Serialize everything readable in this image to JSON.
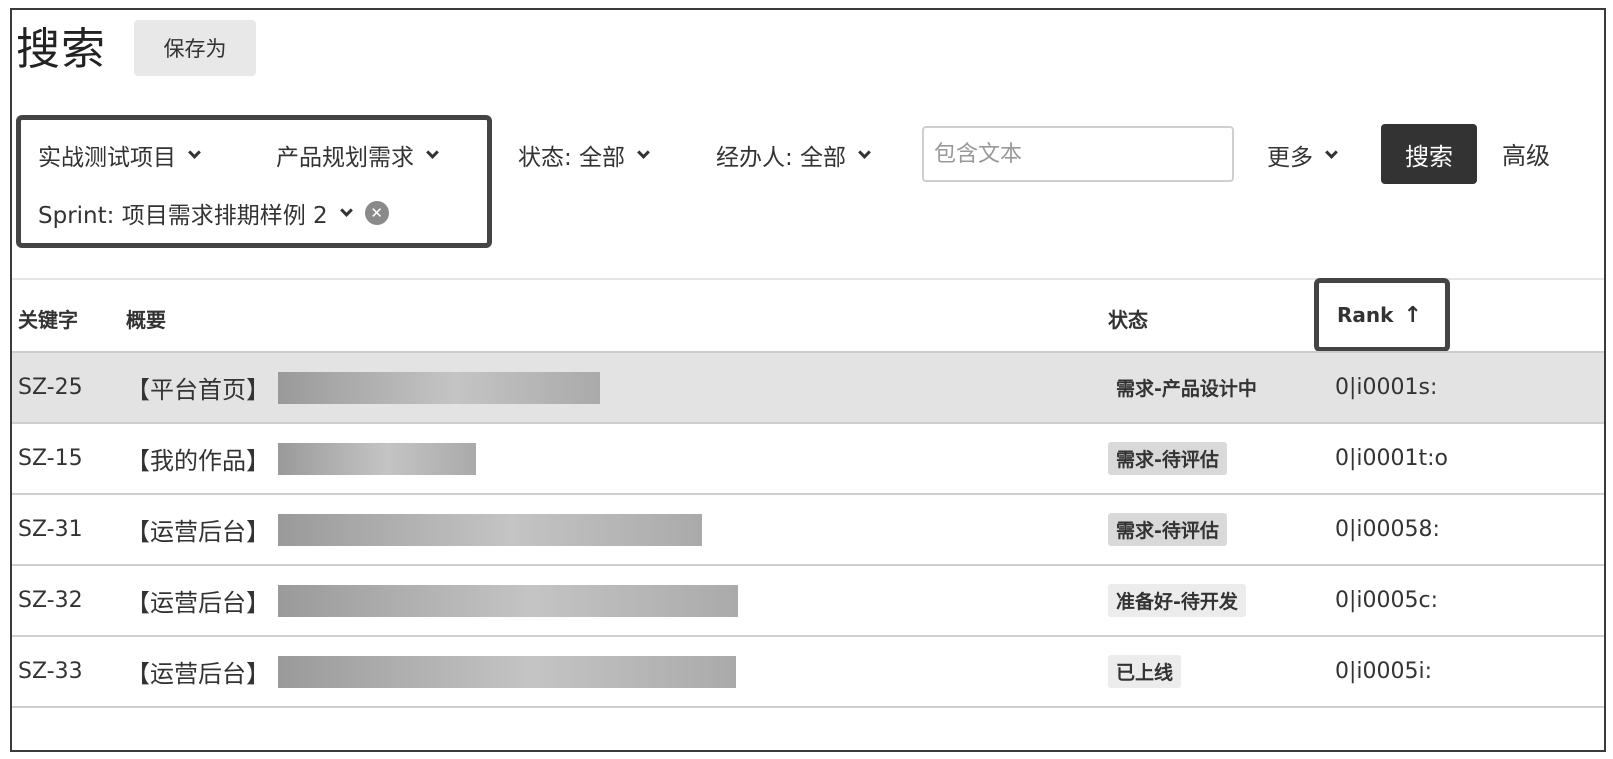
{
  "header": {
    "title": "搜索",
    "save_as_label": "保存为"
  },
  "filters": {
    "project": "实战测试项目",
    "issue_type": "产品规划需求",
    "status": "状态: 全部",
    "assignee": "经办人: 全部",
    "sprint": "Sprint: 项目需求排期样例 2",
    "text_placeholder": "包含文本",
    "more": "更多",
    "search_label": "搜索",
    "advanced_label": "高级"
  },
  "table": {
    "columns": {
      "key": "关键字",
      "summary": "概要",
      "status": "状态",
      "rank": "Rank",
      "rank_sort": "↑"
    },
    "rows": [
      {
        "key": "SZ-25",
        "summary": "【平台首页】",
        "status": "需求-产品设计中",
        "rank": "0|i0001s:"
      },
      {
        "key": "SZ-15",
        "summary": "【我的作品】",
        "status": "需求-待评估",
        "rank": "0|i0001t:o"
      },
      {
        "key": "SZ-31",
        "summary": "【运营后台】",
        "status": "需求-待评估",
        "rank": "0|i00058:"
      },
      {
        "key": "SZ-32",
        "summary": "【运营后台】",
        "status": "准备好-待开发",
        "rank": "0|i0005c:"
      },
      {
        "key": "SZ-33",
        "summary": "【运营后台】",
        "status": "已上线",
        "rank": "0|i0005i:"
      }
    ]
  },
  "icons": {
    "dropdown": "chevron-down-icon",
    "clear": "clear-icon",
    "sort": "sort-ascending-icon"
  }
}
